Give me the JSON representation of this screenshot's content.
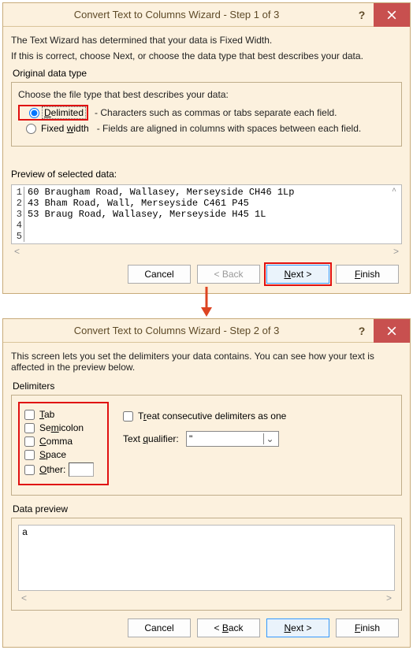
{
  "step1": {
    "title": "Convert Text to Columns Wizard - Step 1 of 3",
    "intro1": "The Text Wizard has determined that your data is Fixed Width.",
    "intro2": "If this is correct, choose Next, or choose the data type that best describes your data.",
    "group_label": "Original data type",
    "choose_label": "Choose the file type that best describes your data:",
    "delimited_label": "Delimited",
    "delimited_desc": "- Characters such as commas or tabs separate each field.",
    "fixed_label": "Fixed width",
    "fixed_desc": "- Fields are aligned in columns with spaces between each field.",
    "preview_label": "Preview of selected data:",
    "preview_rows": [
      {
        "n": "1",
        "t": "60 Braugham Road, Wallasey, Merseyside CH46 1Lp"
      },
      {
        "n": "2",
        "t": "43 Bham Road, Wall, Merseyside C461 P45"
      },
      {
        "n": "3",
        "t": "53 Braug Road, Wallasey, Merseyside H45 1L"
      },
      {
        "n": "4",
        "t": ""
      },
      {
        "n": "5",
        "t": ""
      }
    ],
    "btn_cancel": "Cancel",
    "btn_back": "< Back",
    "btn_next": "Next >",
    "btn_finish": "Finish"
  },
  "step2": {
    "title": "Convert Text to Columns Wizard - Step 2 of 3",
    "intro": "This screen lets you set the delimiters your data contains. You can see how your text is affected in the preview below.",
    "group_label": "Delimiters",
    "tab": "Tab",
    "semicolon": "Semicolon",
    "comma": "Comma",
    "space": "Space",
    "other": "Other:",
    "treat": "Treat consecutive delimiters as one",
    "tq_label": "Text qualifier:",
    "tq_value": "\"",
    "dp_label": "Data preview",
    "dp_text": "a",
    "btn_cancel": "Cancel",
    "btn_back": "< Back",
    "btn_next": "Next >",
    "btn_finish": "Finish"
  }
}
